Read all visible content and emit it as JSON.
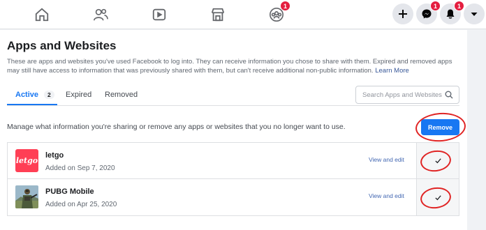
{
  "nav": {
    "notifications_badge": "1",
    "messenger_badge": "1",
    "alerts_badge": "1"
  },
  "page": {
    "title": "Apps and Websites",
    "description": "These are apps and websites you've used Facebook to log into. They can receive information you chose to share with them. Expired and removed apps may still have access to information that was previously shared with them, but can't receive additional non-public information.",
    "learn_more": "Learn More"
  },
  "tabs": [
    {
      "label": "Active",
      "count": "2"
    },
    {
      "label": "Expired"
    },
    {
      "label": "Removed"
    }
  ],
  "search": {
    "placeholder": "Search Apps and Websites"
  },
  "manage": {
    "text": "Manage what information you're sharing or remove any apps or websites that you no longer want to use.",
    "remove_label": "Remove"
  },
  "apps": [
    {
      "logo_text": "letgo",
      "name": "letgo",
      "added": "Added on Sep 7, 2020",
      "action": "View and edit",
      "selected": true
    },
    {
      "name": "PUBG Mobile",
      "added": "Added on Apr 25, 2020",
      "action": "View and edit",
      "selected": true
    }
  ],
  "colors": {
    "accent": "#1877f2",
    "annotation": "#e02424",
    "letgo": "#ff3f55",
    "badge": "#e41e3f"
  }
}
